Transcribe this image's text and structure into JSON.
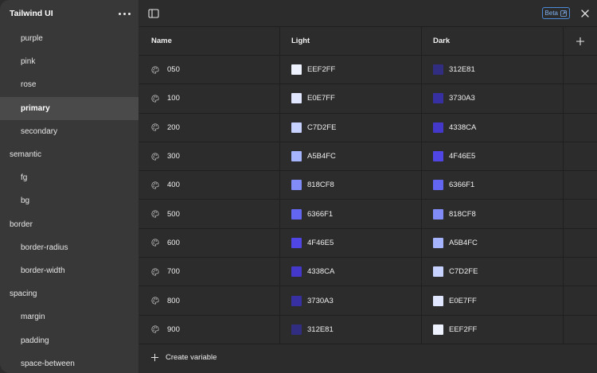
{
  "sidebar": {
    "title": "Tailwind UI",
    "items": [
      {
        "label": "purple",
        "level": "child",
        "active": false
      },
      {
        "label": "pink",
        "level": "child",
        "active": false
      },
      {
        "label": "rose",
        "level": "child",
        "active": false
      },
      {
        "label": "primary",
        "level": "child",
        "active": true
      },
      {
        "label": "secondary",
        "level": "child",
        "active": false
      },
      {
        "label": "semantic",
        "level": "group",
        "active": false
      },
      {
        "label": "fg",
        "level": "child",
        "active": false
      },
      {
        "label": "bg",
        "level": "child",
        "active": false
      },
      {
        "label": "border",
        "level": "group",
        "active": false
      },
      {
        "label": "border-radius",
        "level": "child",
        "active": false
      },
      {
        "label": "border-width",
        "level": "child",
        "active": false
      },
      {
        "label": "spacing",
        "level": "group",
        "active": false
      },
      {
        "label": "margin",
        "level": "child",
        "active": false
      },
      {
        "label": "padding",
        "level": "child",
        "active": false
      },
      {
        "label": "space-between",
        "level": "child",
        "active": false
      }
    ]
  },
  "topbar": {
    "beta_label": "Beta"
  },
  "table": {
    "headers": {
      "name": "Name",
      "light": "Light",
      "dark": "Dark"
    },
    "rows": [
      {
        "name": "050",
        "light": "EEF2FF",
        "dark": "312E81"
      },
      {
        "name": "100",
        "light": "E0E7FF",
        "dark": "3730A3"
      },
      {
        "name": "200",
        "light": "C7D2FE",
        "dark": "4338CA"
      },
      {
        "name": "300",
        "light": "A5B4FC",
        "dark": "4F46E5"
      },
      {
        "name": "400",
        "light": "818CF8",
        "dark": "6366F1"
      },
      {
        "name": "500",
        "light": "6366F1",
        "dark": "818CF8"
      },
      {
        "name": "600",
        "light": "4F46E5",
        "dark": "A5B4FC"
      },
      {
        "name": "700",
        "light": "4338CA",
        "dark": "C7D2FE"
      },
      {
        "name": "800",
        "light": "3730A3",
        "dark": "E0E7FF"
      },
      {
        "name": "900",
        "light": "312E81",
        "dark": "EEF2FF"
      }
    ]
  },
  "footer": {
    "create_label": "Create variable"
  },
  "colors": {
    "accent": "#4d8ad8",
    "sidebar_bg": "#383838",
    "main_bg": "#2c2c2c"
  }
}
